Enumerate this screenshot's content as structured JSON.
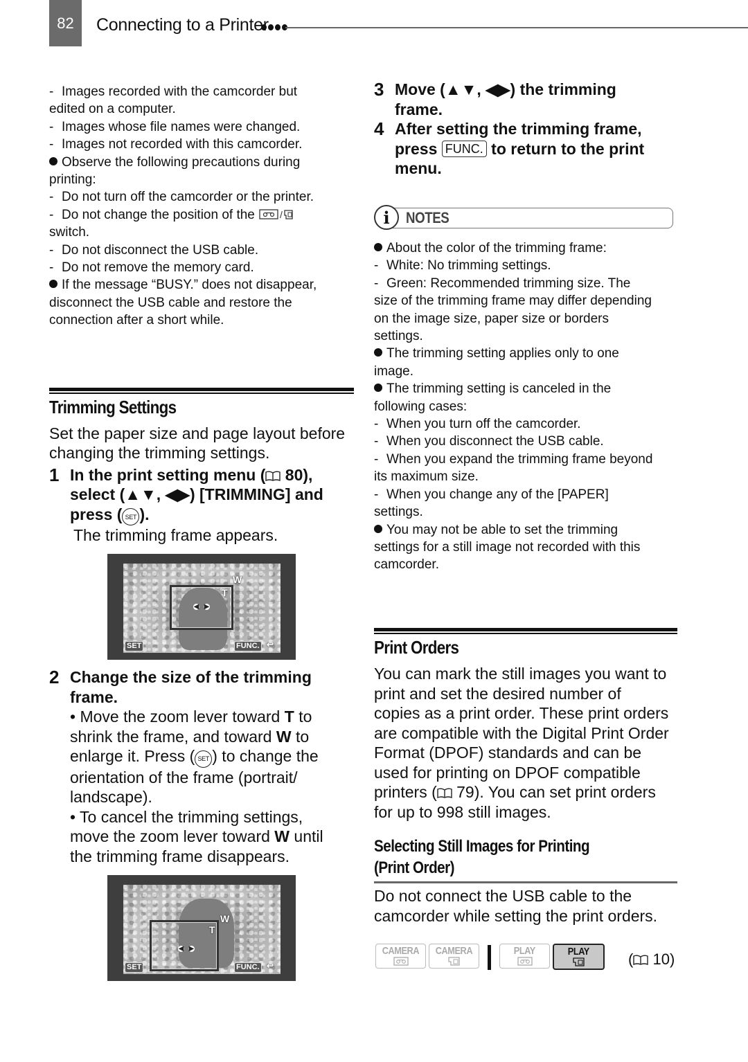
{
  "header": {
    "page_number": "82",
    "title": "Connecting to a Printer"
  },
  "left_column": {
    "intro_items": [
      {
        "type": "dash",
        "lines": [
          "Images recorded with the camcorder but",
          "edited on a computer."
        ]
      },
      {
        "type": "dash",
        "lines": [
          "Images whose file names were changed."
        ]
      },
      {
        "type": "dash",
        "lines": [
          "Images not recorded with this camcorder."
        ]
      },
      {
        "type": "bullet",
        "lines": [
          "Observe the following precautions during",
          "printing:"
        ]
      },
      {
        "type": "dash",
        "lines": [
          "Do not turn off the camcorder or the printer."
        ]
      },
      {
        "type": "dash",
        "lines": [
          "Do not change the position of the",
          "switch."
        ],
        "icon_after_first_line": "tape-card-switch-icon"
      },
      {
        "type": "dash",
        "lines": [
          "Do not disconnect the USB cable."
        ]
      },
      {
        "type": "dash",
        "lines": [
          "Do not remove the memory card."
        ]
      },
      {
        "type": "bullet",
        "lines": [
          "If the message “BUSY.” does not disappear,",
          "disconnect the USB cable and restore the",
          "connection after a short while."
        ]
      }
    ],
    "trimming_section": {
      "title": "Trimming Settings",
      "intro": [
        "Set the paper size and page layout before",
        "changing the trimming settings."
      ],
      "step1": {
        "number": "1",
        "line1_a": "In the print setting menu (",
        "line1_b": " 80),",
        "line2_a": "select (▲▼, ◀▶) [TRIMMING] and",
        "line3_a": "press (",
        "line3_b": ").",
        "result": "The trimming frame appears."
      },
      "step2": {
        "number": "2",
        "heading": [
          "Change the size of the trimming",
          "frame."
        ],
        "bullet1": {
          "l1a": "• Move the zoom lever toward ",
          "l1b": "T",
          "l1c": " to",
          "l2a": "shrink the frame, and toward ",
          "l2b": "W",
          "l2c": " to",
          "l3a": "enlarge it. Press (",
          "l3b": ") to change the",
          "l4": "orientation of the frame (portrait/",
          "l5": "landscape)."
        },
        "bullet2": {
          "l1": "• To cancel the trimming settings,",
          "l2a": "move the zoom lever toward ",
          "l2b": "W",
          "l2c": " until",
          "l3": "the trimming frame disappears."
        }
      }
    },
    "lcd": {
      "set_label": "SET",
      "func_label": "FUNC.",
      "t_label": "T",
      "w_label": "W"
    },
    "set_icon_label": "SET"
  },
  "right_column": {
    "step3": {
      "number": "3",
      "lines": [
        "Move (▲▼, ◀▶) the trimming",
        "frame."
      ]
    },
    "step4": {
      "number": "4",
      "line1": "After setting the trimming frame,",
      "line2a": "press ",
      "func_key": "FUNC.",
      "line2b": " to return to the print",
      "line3": "menu."
    },
    "notes_label": "NOTES",
    "notes_items": [
      {
        "type": "bullet",
        "lines": [
          "About the color of the trimming frame:"
        ]
      },
      {
        "type": "dash",
        "lines": [
          "White: No trimming settings."
        ]
      },
      {
        "type": "dash",
        "lines": [
          "Green: Recommended trimming size. The",
          "size of the trimming frame may differ depending",
          "on the image size, paper size or borders",
          "settings."
        ]
      },
      {
        "type": "bullet",
        "lines": [
          "The trimming setting applies only to one",
          "image."
        ]
      },
      {
        "type": "bullet",
        "lines": [
          "The trimming setting is canceled in the",
          "following cases:"
        ]
      },
      {
        "type": "dash",
        "lines": [
          "When you turn off the camcorder."
        ]
      },
      {
        "type": "dash",
        "lines": [
          "When you disconnect the USB cable."
        ]
      },
      {
        "type": "dash",
        "lines": [
          "When you expand the trimming frame beyond",
          "its maximum size."
        ]
      },
      {
        "type": "dash",
        "lines": [
          "When you change any of the [PAPER]",
          "settings."
        ]
      },
      {
        "type": "bullet",
        "lines": [
          "You may not be able to set the trimming",
          "settings for a still image not recorded with this",
          "camcorder."
        ]
      }
    ],
    "print_orders": {
      "title": "Print Orders",
      "body": [
        "You can mark the still images you want to",
        "print and set the desired number of",
        "copies as a print order. These print orders",
        "are compatible with the Digital Print Order",
        "Format (DPOF) standards and can be",
        "used for printing on DPOF compatible"
      ],
      "body_ref_a": "printers (",
      "body_ref_b": " 79). You can set print orders",
      "body_last": "for up to 998 still images."
    },
    "subsection": {
      "title": [
        "Selecting Still Images for Printing",
        "(Print Order)"
      ],
      "body": [
        "Do not connect the USB cable to the",
        "camcorder while setting the print orders."
      ]
    },
    "modes": [
      {
        "label": "CAMERA",
        "media": "tape",
        "active": false
      },
      {
        "label": "CAMERA",
        "media": "card",
        "active": false
      },
      {
        "label": "PLAY",
        "media": "tape",
        "active": false
      },
      {
        "label": "PLAY",
        "media": "card",
        "active": true
      }
    ],
    "mode_ref": "10"
  }
}
